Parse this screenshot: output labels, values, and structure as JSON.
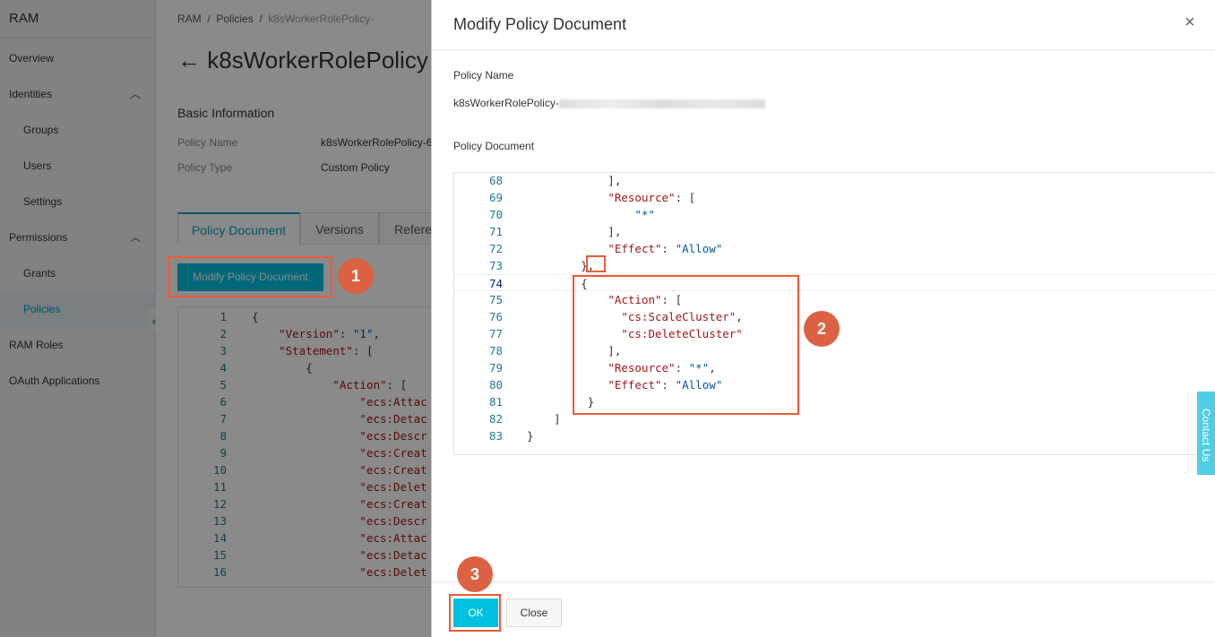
{
  "sidebar": {
    "brand": "RAM",
    "items": [
      {
        "label": "Overview"
      },
      {
        "label": "Identities"
      },
      {
        "label": "Groups"
      },
      {
        "label": "Users"
      },
      {
        "label": "Settings"
      },
      {
        "label": "Permissions"
      },
      {
        "label": "Grants"
      },
      {
        "label": "Policies"
      },
      {
        "label": "RAM Roles"
      },
      {
        "label": "OAuth Applications"
      }
    ],
    "collapse_icon": "«"
  },
  "main": {
    "breadcrumb": [
      "RAM",
      "Policies",
      "k8sWorkerRolePolicy-"
    ],
    "title": "k8sWorkerRolePolicy",
    "section": "Basic Information",
    "fields": [
      {
        "label": "Policy Name",
        "value": "k8sWorkerRolePolicy-6"
      },
      {
        "label": "Policy Type",
        "value": "Custom Policy"
      }
    ],
    "tabs": [
      "Policy Document",
      "Versions",
      "Refere"
    ],
    "modify_button": "Modify Policy Document",
    "code": [
      {
        "n": "1",
        "t": [
          [
            "p",
            "{"
          ]
        ]
      },
      {
        "n": "2",
        "t": [
          [
            "p",
            "    "
          ],
          [
            "k",
            "\"Version\""
          ],
          [
            "p",
            ": "
          ],
          [
            "s",
            "\"1\""
          ],
          [
            "p",
            ","
          ]
        ]
      },
      {
        "n": "3",
        "t": [
          [
            "p",
            "    "
          ],
          [
            "k",
            "\"Statement\""
          ],
          [
            "p",
            ": ["
          ]
        ]
      },
      {
        "n": "4",
        "t": [
          [
            "p",
            "        {"
          ]
        ]
      },
      {
        "n": "5",
        "t": [
          [
            "p",
            "            "
          ],
          [
            "k",
            "\"Action\""
          ],
          [
            "p",
            ": ["
          ]
        ]
      },
      {
        "n": "6",
        "t": [
          [
            "p",
            "                "
          ],
          [
            "k",
            "\"ecs:Attac"
          ]
        ]
      },
      {
        "n": "7",
        "t": [
          [
            "p",
            "                "
          ],
          [
            "k",
            "\"ecs:Detac"
          ]
        ]
      },
      {
        "n": "8",
        "t": [
          [
            "p",
            "                "
          ],
          [
            "k",
            "\"ecs:Descr"
          ]
        ]
      },
      {
        "n": "9",
        "t": [
          [
            "p",
            "                "
          ],
          [
            "k",
            "\"ecs:Creat"
          ]
        ]
      },
      {
        "n": "10",
        "t": [
          [
            "p",
            "                "
          ],
          [
            "k",
            "\"ecs:Creat"
          ]
        ]
      },
      {
        "n": "11",
        "t": [
          [
            "p",
            "                "
          ],
          [
            "k",
            "\"ecs:Delet"
          ]
        ]
      },
      {
        "n": "12",
        "t": [
          [
            "p",
            "                "
          ],
          [
            "k",
            "\"ecs:Creat"
          ]
        ]
      },
      {
        "n": "13",
        "t": [
          [
            "p",
            "                "
          ],
          [
            "k",
            "\"ecs:Descr"
          ]
        ]
      },
      {
        "n": "14",
        "t": [
          [
            "p",
            "                "
          ],
          [
            "k",
            "\"ecs:Attac"
          ]
        ]
      },
      {
        "n": "15",
        "t": [
          [
            "p",
            "                "
          ],
          [
            "k",
            "\"ecs:Detac"
          ]
        ]
      },
      {
        "n": "16",
        "t": [
          [
            "p",
            "                "
          ],
          [
            "k",
            "\"ecs:Delet"
          ]
        ]
      }
    ]
  },
  "modal": {
    "title": "Modify Policy Document",
    "close_icon": "×",
    "policy_name_label": "Policy Name",
    "policy_name_value": "k8sWorkerRolePolicy-",
    "policy_document_label": "Policy Document",
    "code": [
      {
        "n": "68",
        "t": [
          [
            "p",
            "            ],"
          ]
        ]
      },
      {
        "n": "69",
        "t": [
          [
            "p",
            "            "
          ],
          [
            "k",
            "\"Resource\""
          ],
          [
            "p",
            ": ["
          ]
        ]
      },
      {
        "n": "70",
        "t": [
          [
            "p",
            "                "
          ],
          [
            "s",
            "\"*\""
          ]
        ]
      },
      {
        "n": "71",
        "t": [
          [
            "p",
            "            ],"
          ]
        ]
      },
      {
        "n": "72",
        "t": [
          [
            "p",
            "            "
          ],
          [
            "k",
            "\"Effect\""
          ],
          [
            "p",
            ": "
          ],
          [
            "s",
            "\"Allow\""
          ]
        ]
      },
      {
        "n": "73",
        "t": [
          [
            "p",
            "        },"
          ]
        ]
      },
      {
        "n": "74",
        "t": [
          [
            "p",
            "        {"
          ]
        ]
      },
      {
        "n": "75",
        "t": [
          [
            "p",
            "            "
          ],
          [
            "k",
            "\"Action\""
          ],
          [
            "p",
            ": ["
          ]
        ]
      },
      {
        "n": "76",
        "t": [
          [
            "p",
            "              "
          ],
          [
            "k",
            "\"cs:ScaleCluster\""
          ],
          [
            "p",
            ","
          ]
        ]
      },
      {
        "n": "77",
        "t": [
          [
            "p",
            "              "
          ],
          [
            "k",
            "\"cs:DeleteCluster\""
          ]
        ]
      },
      {
        "n": "78",
        "t": [
          [
            "p",
            "            ],"
          ]
        ]
      },
      {
        "n": "79",
        "t": [
          [
            "p",
            "            "
          ],
          [
            "k",
            "\"Resource\""
          ],
          [
            "p",
            ": "
          ],
          [
            "s",
            "\"*\""
          ],
          [
            "p",
            ","
          ]
        ]
      },
      {
        "n": "80",
        "t": [
          [
            "p",
            "            "
          ],
          [
            "k",
            "\"Effect\""
          ],
          [
            "p",
            ": "
          ],
          [
            "s",
            "\"Allow\""
          ]
        ]
      },
      {
        "n": "81",
        "t": [
          [
            "p",
            "         }"
          ]
        ]
      },
      {
        "n": "82",
        "t": [
          [
            "p",
            "    ]"
          ]
        ]
      },
      {
        "n": "83",
        "t": [
          [
            "p",
            "}"
          ]
        ]
      }
    ],
    "ok_button": "OK",
    "close_button": "Close"
  },
  "annotations": [
    "1",
    "2",
    "3"
  ],
  "contact_us": "Contact Us",
  "colors": {
    "accent": "#00c1de",
    "annotation": "#ef5a36",
    "badge": "#dc6243"
  }
}
